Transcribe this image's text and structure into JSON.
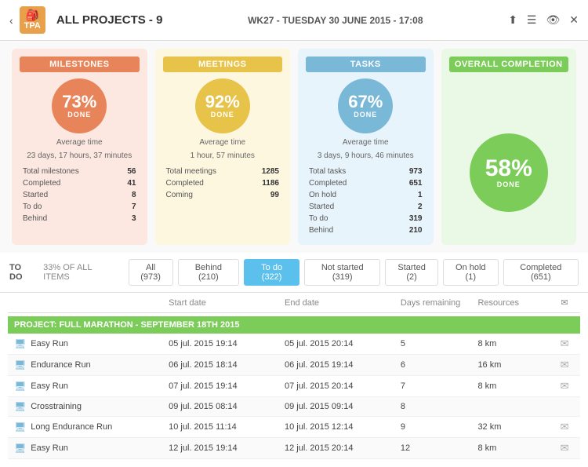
{
  "header": {
    "back_label": "‹",
    "logo_text": "TPA",
    "logo_icon": "🎒",
    "title": "ALL PROJECTS - 9",
    "date_label": "WK27 - TUESDAY 30 JUNE 2015 - 17:08",
    "action_share": "⬆",
    "action_menu": "☰",
    "action_view": "👁",
    "action_close": "✕"
  },
  "cards": {
    "milestones": {
      "title": "MILESTONES",
      "pct": "73%",
      "done_label": "DONE",
      "avg_label": "Average time",
      "avg_value": "23 days, 17 hours, 37 minutes",
      "stats": [
        {
          "label": "Total milestones",
          "value": "56"
        },
        {
          "label": "Completed",
          "value": "41"
        },
        {
          "label": "Started",
          "value": "8"
        },
        {
          "label": "To do",
          "value": "7"
        },
        {
          "label": "Behind",
          "value": "3"
        }
      ]
    },
    "meetings": {
      "title": "MEETINGS",
      "pct": "92%",
      "done_label": "DONE",
      "avg_label": "Average time",
      "avg_value": "1 hour, 57 minutes",
      "stats": [
        {
          "label": "Total meetings",
          "value": "1285"
        },
        {
          "label": "Completed",
          "value": "1186"
        },
        {
          "label": "Coming",
          "value": "99"
        }
      ]
    },
    "tasks": {
      "title": "TASKS",
      "pct": "67%",
      "done_label": "DONE",
      "avg_label": "Average time",
      "avg_value": "3 days, 9 hours, 46 minutes",
      "stats": [
        {
          "label": "Total tasks",
          "value": "973"
        },
        {
          "label": "Completed",
          "value": "651"
        },
        {
          "label": "On hold",
          "value": "1"
        },
        {
          "label": "Started",
          "value": "2"
        },
        {
          "label": "To do",
          "value": "319"
        },
        {
          "label": "Behind",
          "value": "210"
        }
      ]
    },
    "completion": {
      "title": "OVERALL COMPLETION",
      "pct": "58%",
      "done_label": "DONE"
    }
  },
  "filter_bar": {
    "todo_label": "TO DO",
    "pct_label": "33% OF ALL ITEMS",
    "buttons": [
      {
        "label": "All (973)",
        "active": false
      },
      {
        "label": "Behind (210)",
        "active": false
      },
      {
        "label": "To do (322)",
        "active": true
      },
      {
        "label": "Not started (319)",
        "active": false
      },
      {
        "label": "Started (2)",
        "active": false
      },
      {
        "label": "On hold (1)",
        "active": false
      },
      {
        "label": "Completed (651)",
        "active": false
      }
    ]
  },
  "table": {
    "headers": {
      "name": "",
      "start": "Start date",
      "end": "End date",
      "days": "Days remaining",
      "resources": "Resources",
      "mail": "✉"
    },
    "project_label": "PROJECT: FULL MARATHON - SEPTEMBER 18TH 2015",
    "rows": [
      {
        "name": "Easy Run",
        "start": "05 jul. 2015 19:14",
        "end": "05 jul. 2015 20:14",
        "days": "5",
        "resources": "8 km",
        "has_mail": true
      },
      {
        "name": "Endurance Run",
        "start": "06 jul. 2015 18:14",
        "end": "06 jul. 2015 19:14",
        "days": "6",
        "resources": "16 km",
        "has_mail": true
      },
      {
        "name": "Easy Run",
        "start": "07 jul. 2015 19:14",
        "end": "07 jul. 2015 20:14",
        "days": "7",
        "resources": "8 km",
        "has_mail": true
      },
      {
        "name": "Crosstraining",
        "start": "09 jul. 2015 08:14",
        "end": "09 jul. 2015 09:14",
        "days": "8",
        "resources": "",
        "has_mail": false
      },
      {
        "name": "Long Endurance Run",
        "start": "10 jul. 2015 11:14",
        "end": "10 jul. 2015 12:14",
        "days": "9",
        "resources": "32 km",
        "has_mail": true
      },
      {
        "name": "Easy Run",
        "start": "12 jul. 2015 19:14",
        "end": "12 jul. 2015 20:14",
        "days": "12",
        "resources": "8 km",
        "has_mail": true
      }
    ]
  }
}
